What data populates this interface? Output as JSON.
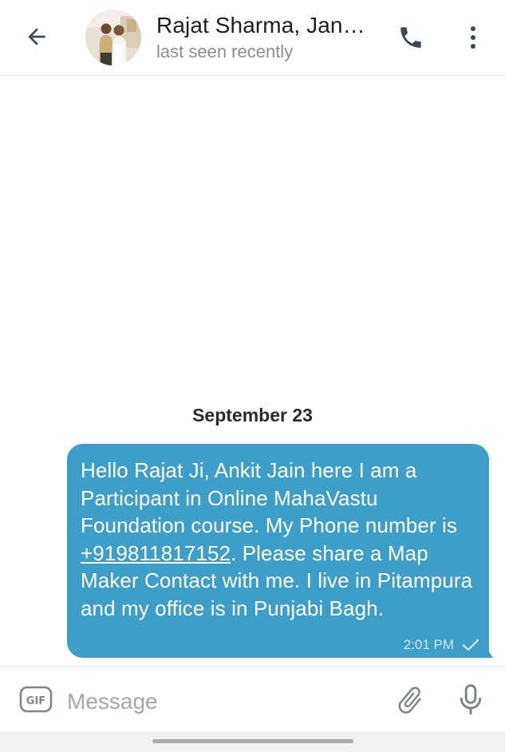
{
  "header": {
    "title": "Rajat Sharma, Jan…",
    "status": "last seen recently"
  },
  "chat": {
    "date_separator": "September 23",
    "messages": [
      {
        "text_before_link": "Hello Rajat Ji, Ankit Jain here I am a Participant in Online MahaVastu Foundation course. My Phone number is ",
        "link": "+919811817152",
        "text_after_link": ". Please share a Map Maker Contact with me. I live in Pitampura and my office is in Punjabi Bagh.",
        "time": "2:01 PM",
        "outgoing": true,
        "status_icon": "single-check-icon"
      }
    ]
  },
  "input": {
    "placeholder": "Message",
    "value": ""
  },
  "icons": {
    "back": "back-arrow-icon",
    "call": "phone-icon",
    "menu": "more-vertical-icon",
    "gif": "gif-icon",
    "attach": "paperclip-icon",
    "mic": "microphone-icon"
  },
  "colors": {
    "bubble": "#3f9ec7",
    "icon": "#3b4a54"
  }
}
